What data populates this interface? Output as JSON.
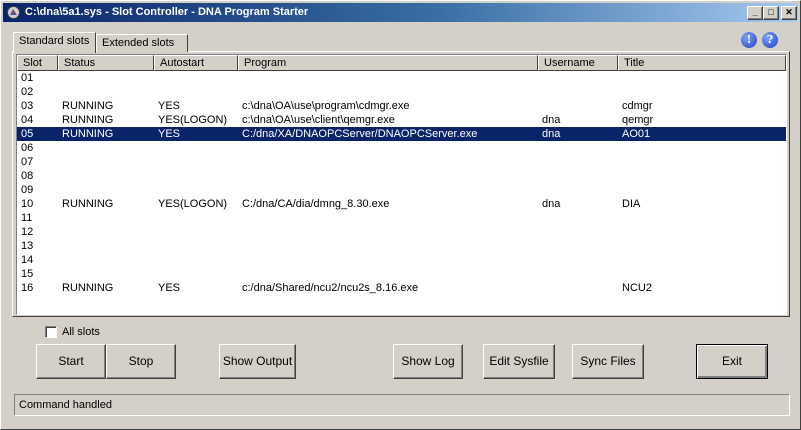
{
  "window": {
    "title": "C:\\dna\\5a1.sys - Slot Controller - DNA Program Starter",
    "minimize_glyph": "_",
    "maximize_glyph": "□",
    "close_glyph": "✕"
  },
  "tabs": [
    {
      "label": "Standard slots",
      "active": true
    },
    {
      "label": "Extended slots",
      "active": false
    }
  ],
  "help": {
    "info_glyph": "!",
    "help_glyph": "?"
  },
  "table": {
    "columns": [
      "Slot",
      "Status",
      "Autostart",
      "Program",
      "Username",
      "Title"
    ],
    "rows": [
      {
        "slot": "01",
        "status": "",
        "autostart": "",
        "program": "",
        "username": "",
        "title": ""
      },
      {
        "slot": "02",
        "status": "",
        "autostart": "",
        "program": "",
        "username": "",
        "title": ""
      },
      {
        "slot": "03",
        "status": "RUNNING",
        "autostart": "YES",
        "program": "c:\\dna\\OA\\use\\program\\cdmgr.exe",
        "username": "",
        "title": "cdmgr"
      },
      {
        "slot": "04",
        "status": "RUNNING",
        "autostart": "YES(LOGON)",
        "program": "c:\\dna\\OA\\use\\client\\qemgr.exe",
        "username": "dna",
        "title": "qemgr"
      },
      {
        "slot": "05",
        "status": "RUNNING",
        "autostart": "YES",
        "program": "C:/dna/XA/DNAOPCServer/DNAOPCServer.exe",
        "username": "dna",
        "title": "AO01",
        "selected": true
      },
      {
        "slot": "06",
        "status": "",
        "autostart": "",
        "program": "",
        "username": "",
        "title": ""
      },
      {
        "slot": "07",
        "status": "",
        "autostart": "",
        "program": "",
        "username": "",
        "title": ""
      },
      {
        "slot": "08",
        "status": "",
        "autostart": "",
        "program": "",
        "username": "",
        "title": ""
      },
      {
        "slot": "09",
        "status": "",
        "autostart": "",
        "program": "",
        "username": "",
        "title": ""
      },
      {
        "slot": "10",
        "status": "RUNNING",
        "autostart": "YES(LOGON)",
        "program": "C:/dna/CA/dia/dmng_8.30.exe",
        "username": "dna",
        "title": "DIA"
      },
      {
        "slot": "11",
        "status": "",
        "autostart": "",
        "program": "",
        "username": "",
        "title": ""
      },
      {
        "slot": "12",
        "status": "",
        "autostart": "",
        "program": "",
        "username": "",
        "title": ""
      },
      {
        "slot": "13",
        "status": "",
        "autostart": "",
        "program": "",
        "username": "",
        "title": ""
      },
      {
        "slot": "14",
        "status": "",
        "autostart": "",
        "program": "",
        "username": "",
        "title": ""
      },
      {
        "slot": "15",
        "status": "",
        "autostart": "",
        "program": "",
        "username": "",
        "title": ""
      },
      {
        "slot": "16",
        "status": "RUNNING",
        "autostart": "YES",
        "program": "c:/dna/Shared/ncu2/ncu2s_8.16.exe",
        "username": "",
        "title": "NCU2"
      }
    ]
  },
  "all_slots": {
    "label": "All slots",
    "checked": false
  },
  "buttons": {
    "start": "Start",
    "stop": "Stop",
    "show_output": "Show Output",
    "show_log": "Show Log",
    "edit_sysfile": "Edit Sysfile",
    "sync_files": "Sync Files",
    "exit": "Exit"
  },
  "statusbar": {
    "text": "Command handled"
  },
  "colors": {
    "selection": "#0a246a",
    "titlebar_start": "#0a246a",
    "titlebar_end": "#a6caf0"
  }
}
